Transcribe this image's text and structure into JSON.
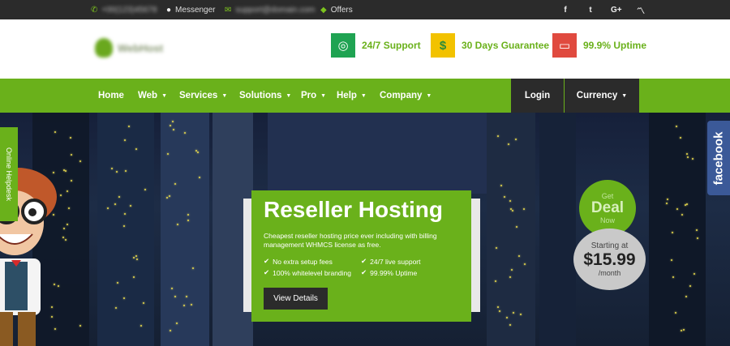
{
  "topbar": {
    "phone": "+00(123)45678",
    "messenger": "Messenger",
    "email": "support@domain.com",
    "offers": "Offers",
    "social": [
      "f",
      "t",
      "G+",
      "rss"
    ]
  },
  "header": {
    "logo_text": "WebHost",
    "features": [
      {
        "icon": "lifebuoy-icon",
        "label": "24/7 Support",
        "color": "#1fa352"
      },
      {
        "icon": "money-icon",
        "label": "30 Days Guarantee",
        "color": "#f2c200"
      },
      {
        "icon": "browser-icon",
        "label": "99.9% Uptime",
        "color": "#e04a3f"
      }
    ]
  },
  "nav": {
    "items": [
      "Home",
      "Web",
      "Services",
      "Solutions",
      "Pro",
      "Help",
      "Company"
    ],
    "login": "Login",
    "currency": "Currency"
  },
  "hero": {
    "side_tab": "Online Helpdesk",
    "facebook_tab": "facebook",
    "card": {
      "title": "Reseller Hosting",
      "description": "Cheapest reseller hosting price ever including with billing management WHMCS license as free.",
      "features": [
        "No extra setup fees",
        "24/7 live support",
        "100% whitelevel branding",
        "99.99% Uptime"
      ],
      "button": "View Details"
    },
    "deal": {
      "line1": "Get",
      "line2": "Deal",
      "line3": "Now"
    },
    "price": {
      "label": "Starting at",
      "amount": "$15.99",
      "period": "/month"
    }
  },
  "colors": {
    "brand_green": "#6ab11b",
    "dark": "#2b2b2b",
    "facebook": "#3b5998"
  }
}
